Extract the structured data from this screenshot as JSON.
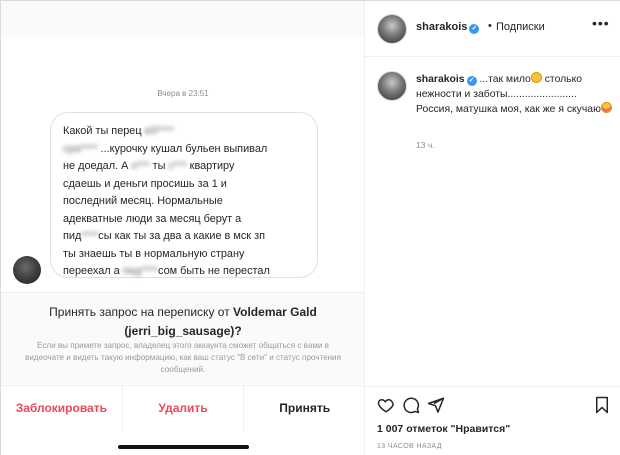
{
  "dm": {
    "timestamp": "Вчера в 23:51",
    "message_lines": [
      {
        "parts": [
          {
            "t": "Какой ты перец ",
            "b": false
          },
          {
            "t": "еб****",
            "b": true
          }
        ]
      },
      {
        "parts": [
          {
            "t": "сра****",
            "b": true
          },
          {
            "t": " ...курочку кушал бульен выпивал",
            "b": false
          }
        ]
      },
      {
        "parts": [
          {
            "t": "не доедал. А ",
            "b": false
          },
          {
            "t": "х***",
            "b": true
          },
          {
            "t": " ты ",
            "b": false
          },
          {
            "t": "с***",
            "b": true
          },
          {
            "t": " квартиру",
            "b": false
          }
        ]
      },
      {
        "parts": [
          {
            "t": "сдаешь и деньги просишь за 1 и",
            "b": false
          }
        ]
      },
      {
        "parts": [
          {
            "t": "последний месяц. Нормальные",
            "b": false
          }
        ]
      },
      {
        "parts": [
          {
            "t": "адекватные люди за месяц берут а",
            "b": false
          }
        ]
      },
      {
        "parts": [
          {
            "t": "пид",
            "b": false
          },
          {
            "t": "****",
            "b": true
          },
          {
            "t": "сы как ты за два а какие в мск зп",
            "b": false
          }
        ]
      },
      {
        "parts": [
          {
            "t": "ты знаешь ты в нормальную страну",
            "b": false
          }
        ]
      },
      {
        "parts": [
          {
            "t": "переехал а ",
            "b": false
          },
          {
            "t": "пид****",
            "b": true
          },
          {
            "t": "сом быть не перестал",
            "b": false
          }
        ]
      }
    ],
    "request": {
      "title_prefix": "Принять запрос на переписку от ",
      "sender_name": "Voldemar Gald",
      "sender_handle": "(jerri_big_sausage)?",
      "info": "Если вы примете запрос, владелец этого аккаунта сможет общаться с вами в видеочате и видеть такую информацию, как ваш статус \"В сети\" и статус прочтения сообщений."
    },
    "actions": {
      "block": "Заблокировать",
      "delete": "Удалить",
      "accept": "Принять"
    },
    "colors": {
      "block": "#ed4956",
      "delete": "#ed4956",
      "accept": "#262626"
    }
  },
  "post": {
    "username": "sharakois",
    "dot": "•",
    "follow_label": "Подписки",
    "more": "•••",
    "caption_username": "sharakois",
    "caption_part1": " ...так мило",
    "caption_part2": " столько нежности и заботы........................",
    "caption_part3": "Россия, матушка моя, как же я скучаю",
    "caption_time": "13 ч.",
    "likes": "1 007 отметок \"Нравится\"",
    "date": "13 часов назад",
    "icons": [
      "heart-icon",
      "comment-icon",
      "share-icon",
      "bookmark-icon"
    ]
  }
}
